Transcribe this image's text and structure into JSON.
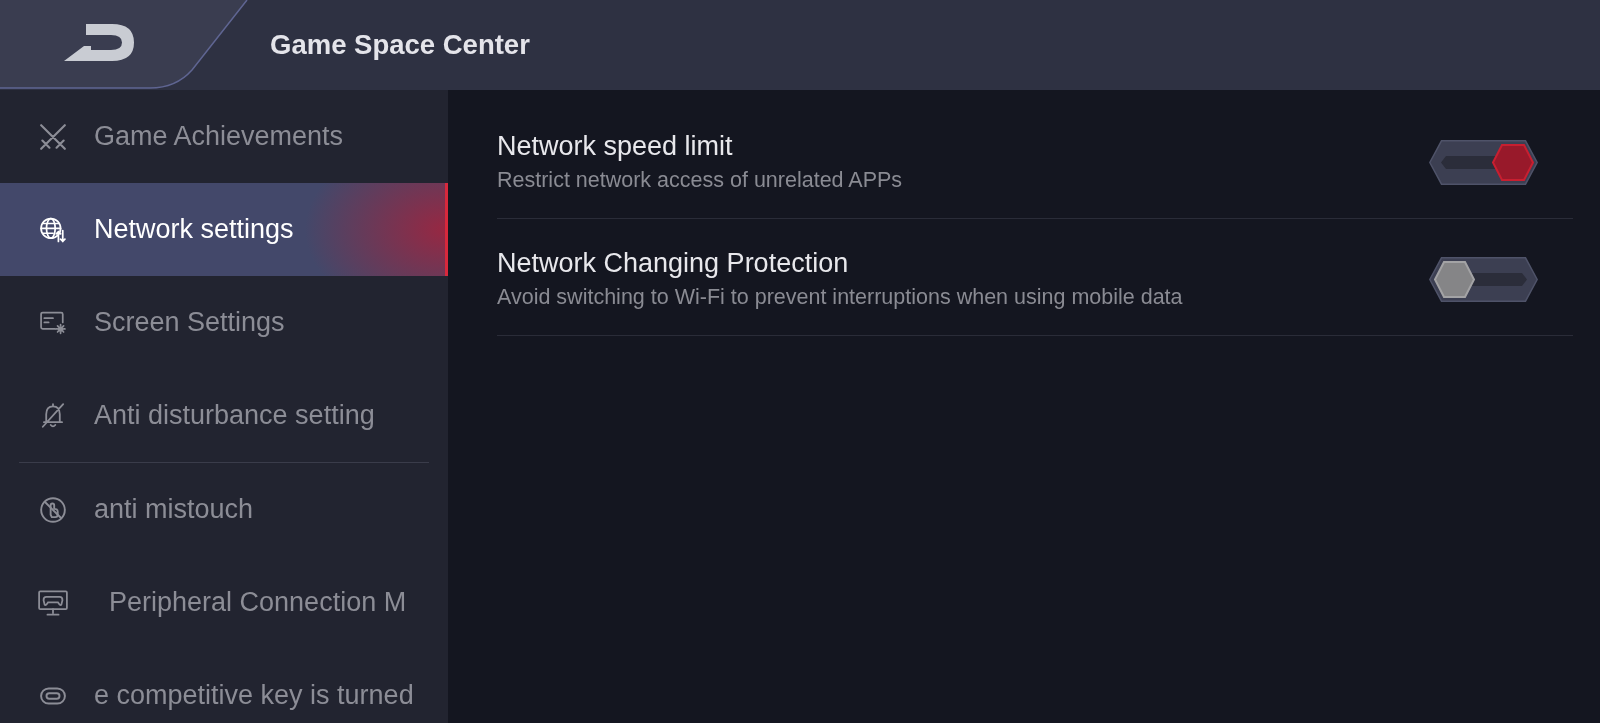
{
  "header": {
    "title": "Game Space Center"
  },
  "sidebar": {
    "groups": [
      {
        "items": [
          {
            "label": "Game Achievements",
            "selected": false
          },
          {
            "label": "Network settings",
            "selected": true
          },
          {
            "label": "Screen Settings",
            "selected": false
          },
          {
            "label": "Anti disturbance setting",
            "selected": false
          }
        ]
      },
      {
        "items": [
          {
            "label": "anti mistouch",
            "selected": false
          },
          {
            "label": "Peripheral Connection M",
            "selected": false
          },
          {
            "label": "e competitive key is turned",
            "selected": false
          }
        ]
      }
    ]
  },
  "settings": [
    {
      "title": "Network speed limit",
      "description": "Restrict network access of unrelated APPs",
      "on": true
    },
    {
      "title": "Network Changing Protection",
      "description": "Avoid switching to Wi-Fi to prevent interruptions when using mobile data",
      "on": false
    }
  ]
}
